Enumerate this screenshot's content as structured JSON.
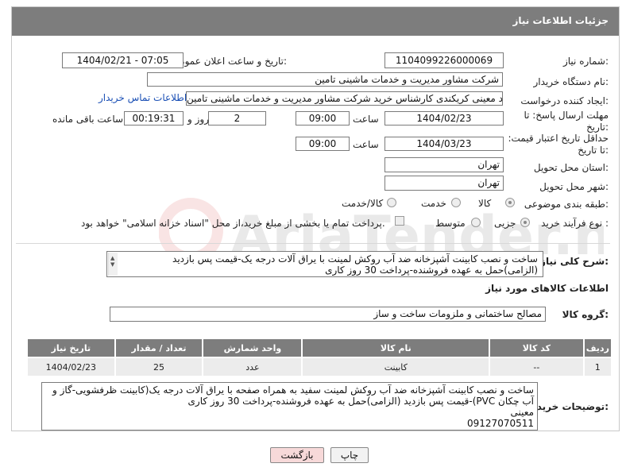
{
  "header": {
    "title": "جزئیات اطلاعات نیاز"
  },
  "fields": {
    "need_number_label": "شماره نیاز:",
    "need_number": "1104099226000069",
    "announce_label": "تاریخ و ساعت اعلان عمومی:",
    "announce_value": "1404/02/21 - 07:05",
    "buyer_org_label": "نام دستگاه خریدار:",
    "buyer_org": "شرکت مشاور مدیریت و خدمات ماشینی تامین",
    "requester_label": "ایجاد کننده درخواست:",
    "requester": "احمد معینی کریکندی کارشناس خرید شرکت مشاور مدیریت و خدمات ماشینی تامین",
    "contact_link": "اطلاعات تماس خریدار",
    "deadline_label": "مهلت ارسال پاسخ: تا تاریخ:",
    "deadline_date": "1404/02/23",
    "time_label": "ساعت",
    "deadline_time": "09:00",
    "days_value": "2",
    "days_label": "روز و",
    "remaining_time": "00:19:31",
    "remaining_label": "ساعت باقی مانده",
    "validity_label": "حداقل تاریخ اعتبار قیمت: تا تاریخ:",
    "validity_date": "1404/03/23",
    "validity_time_label": "ساعت",
    "validity_time": "09:00",
    "province_label": "استان محل تحویل:",
    "province": "تهران",
    "city_label": "شهر محل تحویل:",
    "city": "تهران",
    "category_label": "طبقه بندی موضوعی:",
    "category_options": [
      "کالا",
      "خدمت",
      "کالا/خدمت"
    ],
    "process_label": "نوع فرآیند خرید :",
    "process_options": [
      "جزیی",
      "متوسط"
    ],
    "payment_note": "پرداخت تمام یا بخشی از مبلغ خرید،از محل \"اسناد خزانه اسلامی\" خواهد بود.",
    "desc_label": "شرح کلی نیاز:",
    "desc_text": "ساخت و نصب کابینت آشپزخانه ضد آب روکش لمینت با یراق آلات درجه یک-قیمت پس بازدید (الزامی)حمل به عهده فروشنده-پرداخت 30 روز کاری",
    "goods_info_title": "اطلاعات کالاهای مورد نیاز",
    "goods_group_label": "گروه کالا:",
    "goods_group": "مصالح ساختمانی و ملزومات ساخت و ساز",
    "buyer_notes_label": "توضیحات خریدار:",
    "buyer_notes": "ساخت و نصب کابینت آشپزخانه ضد آب روکش لمینت سفید به همراه صفحه با یراق آلات درجه یک(کابینت ظرفشویی-گاز و آب چکان PVC)-قیمت پس بازدید (الزامی)حمل به عهده فروشنده-پرداخت 30 روز کاری\nمعینی\n09127070511"
  },
  "table": {
    "headers": [
      "ردیف",
      "کد کالا",
      "نام کالا",
      "واحد شمارش",
      "تعداد / مقدار",
      "تاریخ نیاز"
    ],
    "rows": [
      [
        "1",
        "--",
        "کابینت",
        "عدد",
        "25",
        "1404/02/23"
      ]
    ]
  },
  "buttons": {
    "print": "چاپ",
    "back": "بازگشت"
  },
  "watermark": {
    "brand": "AriaTender.neT"
  },
  "colors": {
    "header_bg": "#7d7d7d",
    "link": "#1a4fb5",
    "back_button_bg": "#f7d9d9"
  }
}
